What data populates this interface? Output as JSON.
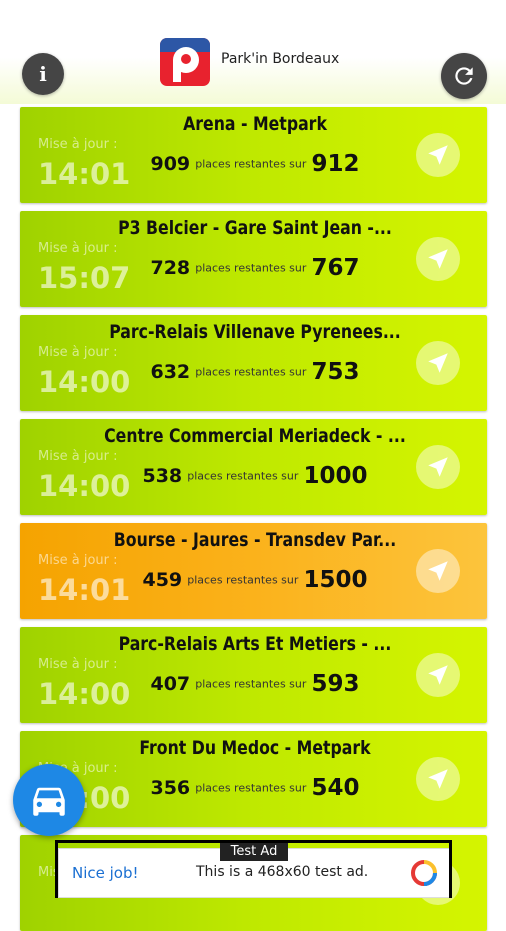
{
  "app": {
    "title": "Park'in Bordeaux"
  },
  "header": {
    "info_label": "i"
  },
  "labels": {
    "updated": "Mise à jour :",
    "remaining_of": "places restantes sur"
  },
  "colors": {
    "green": "#bfe900",
    "orange": "#fbb21b",
    "fab": "#1e88e5"
  },
  "parkings": [
    {
      "name": "Arena - Metpark",
      "time": "14:01",
      "remaining": "909",
      "total": "912",
      "status": "green"
    },
    {
      "name": "P3 Belcier - Gare Saint Jean -...",
      "time": "15:07",
      "remaining": "728",
      "total": "767",
      "status": "green"
    },
    {
      "name": "Parc-Relais Villenave Pyrenees...",
      "time": "14:00",
      "remaining": "632",
      "total": "753",
      "status": "green"
    },
    {
      "name": "Centre Commercial Meriadeck - ...",
      "time": "14:00",
      "remaining": "538",
      "total": "1000",
      "status": "green"
    },
    {
      "name": "Bourse - Jaures - Transdev Par...",
      "time": "14:01",
      "remaining": "459",
      "total": "1500",
      "status": "orange"
    },
    {
      "name": "Parc-Relais Arts Et Metiers - ...",
      "time": "14:00",
      "remaining": "407",
      "total": "593",
      "status": "green"
    },
    {
      "name": "Front Du Medoc - Metpark",
      "time": "14:00",
      "remaining": "356",
      "total": "540",
      "status": "green"
    },
    {
      "name": "",
      "time": "",
      "remaining": "",
      "total": "",
      "status": "green"
    }
  ],
  "ad": {
    "label": "Test Ad",
    "cta": "Nice job!",
    "text": "This is a 468x60 test ad."
  }
}
